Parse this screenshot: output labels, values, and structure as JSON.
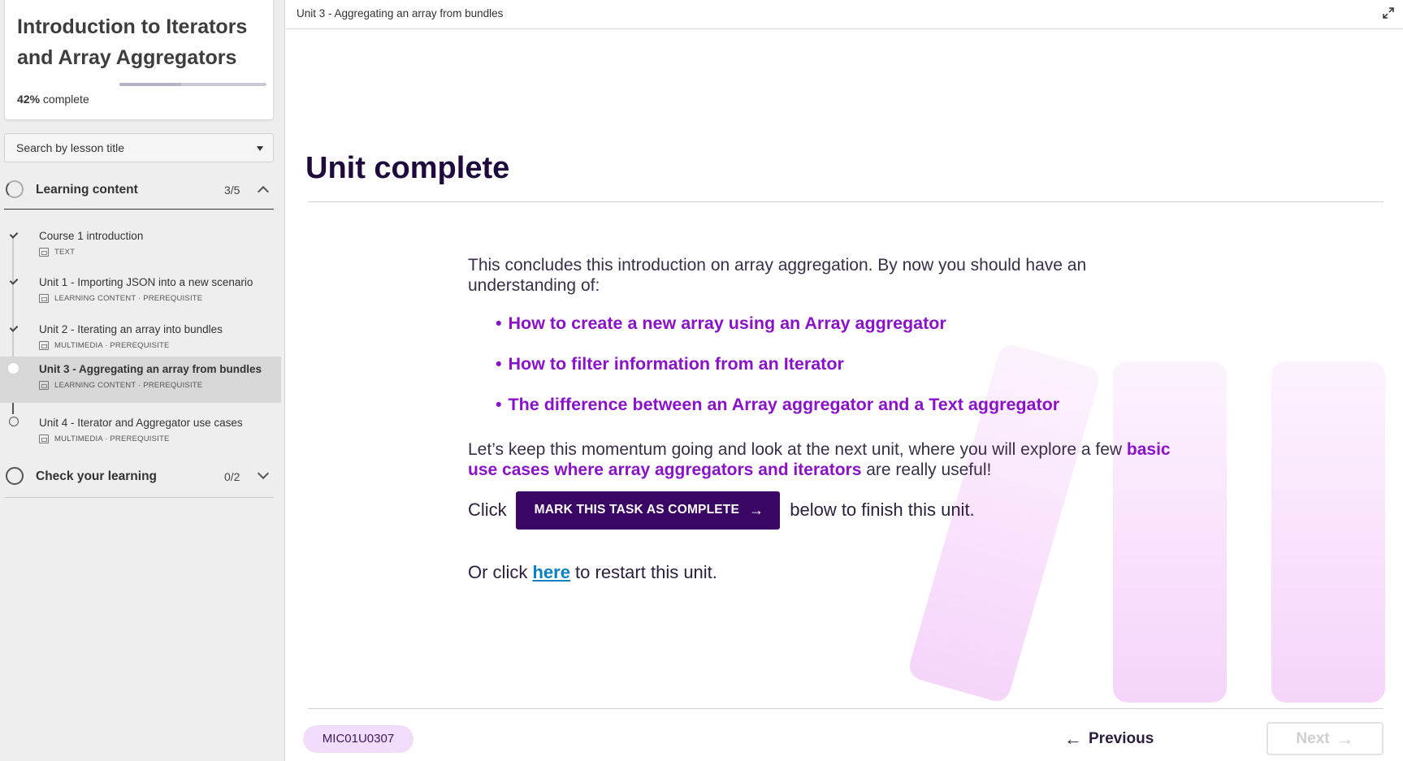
{
  "sidebar": {
    "course_title": "Introduction to Iterators and Array Aggregators",
    "progress_percent": "42%",
    "progress_suffix": " complete",
    "progress_value": 0.42,
    "search_placeholder": "Search by lesson title",
    "sections": [
      {
        "label": "Learning content",
        "count": "3/5",
        "expanded": true,
        "lessons": [
          {
            "title": "Course 1 introduction",
            "meta": "TEXT",
            "status": "complete"
          },
          {
            "title": "Unit 1 - Importing JSON into a new scenario",
            "meta": "LEARNING CONTENT · PREREQUISITE",
            "status": "complete"
          },
          {
            "title": "Unit 2 - Iterating an array into bundles",
            "meta": "MULTIMEDIA · PREREQUISITE",
            "status": "complete"
          },
          {
            "title": "Unit 3 - Aggregating an array from bundles",
            "meta": "LEARNING CONTENT · PREREQUISITE",
            "status": "current"
          },
          {
            "title": "Unit 4 - Iterator and Aggregator use cases",
            "meta": "MULTIMEDIA · PREREQUISITE",
            "status": "not-started"
          }
        ]
      },
      {
        "label": "Check your learning",
        "count": "0/2",
        "expanded": false
      }
    ]
  },
  "main": {
    "breadcrumb": "Unit 3 - Aggregating an array from bundles",
    "heading": "Unit complete",
    "intro": "This concludes this introduction on array aggregation. By now you should have an understanding of:",
    "bullets": [
      "How to create a new array using an Array aggregator",
      "How to filter information from an Iterator",
      "The difference between an Array aggregator and a Text aggregator"
    ],
    "momentum_prefix": "Let’s keep this momentum going and look at the next unit, where you will explore a few ",
    "momentum_highlight": "basic use cases where array aggregators and iterators",
    "momentum_suffix": " are really useful!",
    "click_prefix": "Click",
    "mark_complete_label": "MARK THIS TASK AS COMPLETE",
    "click_suffix": "below to finish this unit.",
    "restart_prefix": "Or click ",
    "restart_link": "here",
    "restart_suffix": " to restart this unit."
  },
  "footer": {
    "code": "MIC01U0307",
    "previous_label": "Previous",
    "next_label": "Next"
  },
  "colors": {
    "accent_purple": "#8a12c9",
    "button_dark": "#3b0764",
    "heading": "#1f0a3d",
    "link": "#0a7fc2",
    "pill": "#f2dcfb"
  }
}
